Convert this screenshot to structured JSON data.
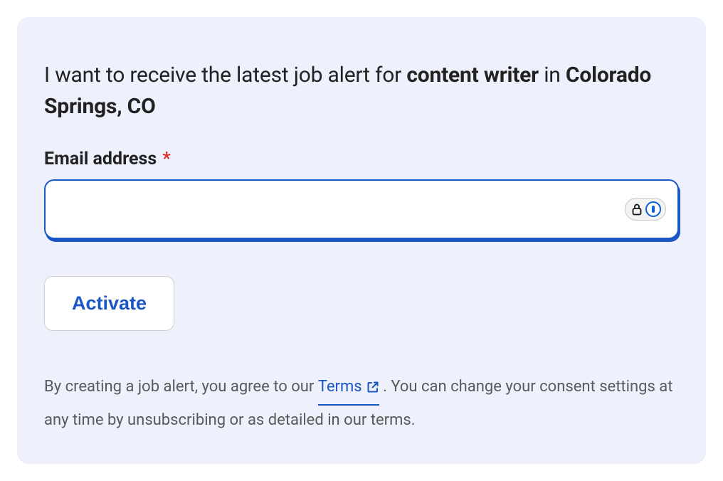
{
  "heading": {
    "prefix": "I want to receive the latest job alert for ",
    "query": "content writer",
    "middle": " in ",
    "location": "Colorado Springs, CO"
  },
  "form": {
    "email_label": "Email address",
    "required_marker": "*",
    "email_value": "",
    "email_placeholder": ""
  },
  "activate_label": "Activate",
  "disclaimer": {
    "before": "By creating a job alert, you agree to our ",
    "terms_label": "Terms",
    "after": " . You can change your consent settings at any time by unsubscribing or as detailed in our terms."
  },
  "icons": {
    "lock": "lock-icon",
    "password_manager": "password-manager-icon",
    "external": "external-link-icon"
  }
}
